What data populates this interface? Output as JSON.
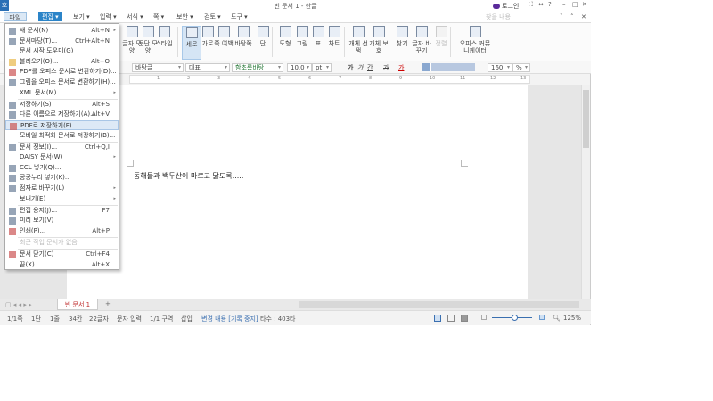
{
  "titlebar": {
    "logo": "호",
    "title": "빈 문서 1 - 한글",
    "login": "로그인",
    "buttons": [
      "⛶",
      "⇔",
      "?",
      "–",
      "□",
      "✕"
    ]
  },
  "menubar": {
    "items": [
      "파일",
      "편집 ▾",
      "보기 ▾",
      "입력 ▾",
      "서식 ▾",
      "쪽 ▾",
      "보안 ▾",
      "검토 ▾",
      "도구 ▾"
    ],
    "search_placeholder": "찾을 내용",
    "right_controls": [
      "˅",
      "˄",
      "✕"
    ]
  },
  "ribbon": {
    "buttons": [
      {
        "label": "글자 모양",
        "icon": "char-shape-icon"
      },
      {
        "label": "문단 모양",
        "icon": "para-shape-icon"
      },
      {
        "label": "스타일",
        "icon": "style-icon"
      },
      {
        "label": "세로",
        "icon": "portrait-icon",
        "selected": true
      },
      {
        "label": "가로",
        "icon": "landscape-icon"
      },
      {
        "label": "쪽 여백",
        "icon": "margin-icon"
      },
      {
        "label": "바탕쪽",
        "icon": "master-page-icon"
      },
      {
        "label": "단",
        "icon": "columns-icon"
      },
      {
        "label": "도형",
        "icon": "shape-icon"
      },
      {
        "label": "그림",
        "icon": "picture-icon"
      },
      {
        "label": "표",
        "icon": "table-icon"
      },
      {
        "label": "차트",
        "icon": "chart-icon"
      },
      {
        "label": "개체 선택",
        "icon": "select-object-icon"
      },
      {
        "label": "개체 보호",
        "icon": "protect-object-icon"
      },
      {
        "label": "찾기",
        "icon": "find-icon"
      },
      {
        "label": "글자 바꾸기",
        "icon": "replace-icon"
      },
      {
        "label": "정렬",
        "icon": "sort-icon",
        "disabled": true
      },
      {
        "label": "오피스 커뮤니케이터",
        "icon": "communicator-icon"
      }
    ]
  },
  "format": {
    "style": "바탕글",
    "lang": "대표",
    "font": "함초롬바탕",
    "size": "10.0",
    "unit": "pt",
    "bold": "가",
    "italic": "가",
    "underline": "간",
    "strike": "가",
    "color": "가",
    "zoom": "160",
    "zoom_unit": "%"
  },
  "ruler": {
    "ticks": [
      "1",
      "2",
      "3",
      "4",
      "5",
      "6",
      "7",
      "8",
      "9",
      "10",
      "11",
      "12",
      "13"
    ]
  },
  "document": {
    "text": "동해물과 백두산이 마르고 닳도록....."
  },
  "tabs": {
    "doc_tab": "빈 문서 1",
    "add": "+"
  },
  "status": {
    "page": "1/1쪽",
    "section": "1단",
    "line": "1줄",
    "col": "34칸",
    "chars": "22글자",
    "mode": "문자 입력",
    "area": "1/1 구역",
    "insert": "삽입",
    "track": "변경 내용 [기록 중지]",
    "typing": "타수 : 403타",
    "zoom": "125%"
  },
  "file_menu": [
    {
      "label": "새 문서(N)",
      "key": "Alt+N",
      "arrow": true,
      "icon": "new-doc-icon"
    },
    {
      "label": "문서마당(T)...",
      "key": "Ctrl+Alt+N",
      "icon": "template-icon"
    },
    {
      "label": "문서 시작 도우미(G)"
    },
    {
      "label": "불러오기(O)...",
      "key": "Alt+O",
      "icon": "open-folder-icon"
    },
    {
      "label": "PDF를 오피스 문서로 변환하기(D)...",
      "icon": "pdf-convert-icon"
    },
    {
      "label": "그림을 오피스 문서로 변환하기(H)...",
      "icon": "image-convert-icon"
    },
    {
      "label": "XML 문서(M)",
      "arrow": true,
      "sep": true
    },
    {
      "label": "저장하기(S)",
      "key": "Alt+S",
      "icon": "save-icon"
    },
    {
      "label": "다른 이름으로 저장하기(A)...",
      "key": "Alt+V",
      "icon": "save-as-icon"
    },
    {
      "label": "PDF로 저장하기(F)...",
      "icon": "pdf-save-icon",
      "highlight": true
    },
    {
      "label": "모바일 최적화 문서로 저장하기(B)...",
      "sep": true
    },
    {
      "label": "문서 정보(I)...",
      "key": "Ctrl+Q,I",
      "icon": "info-icon"
    },
    {
      "label": "DAISY 문서(W)",
      "arrow": true
    },
    {
      "label": "CCL 넣기(Q)...",
      "icon": "ccl-icon"
    },
    {
      "label": "공공누리 넣기(K)...",
      "icon": "kogl-icon"
    },
    {
      "label": "점자로 바꾸기(L)",
      "arrow": true,
      "icon": "braille-icon"
    },
    {
      "label": "보내기(E)",
      "arrow": true,
      "sep": true
    },
    {
      "label": "편집 용지(J)...",
      "key": "F7",
      "icon": "page-setup-icon"
    },
    {
      "label": "미리 보기(V)",
      "icon": "preview-icon"
    },
    {
      "label": "인쇄(P)...",
      "key": "Alt+P",
      "icon": "print-icon",
      "sep": true
    },
    {
      "label": "최근 작업 문서가 없음",
      "disabled": true,
      "sep": true
    },
    {
      "label": "문서 닫기(C)",
      "key": "Ctrl+F4",
      "icon": "close-doc-icon"
    },
    {
      "label": "끝(X)",
      "key": "Alt+X"
    }
  ]
}
